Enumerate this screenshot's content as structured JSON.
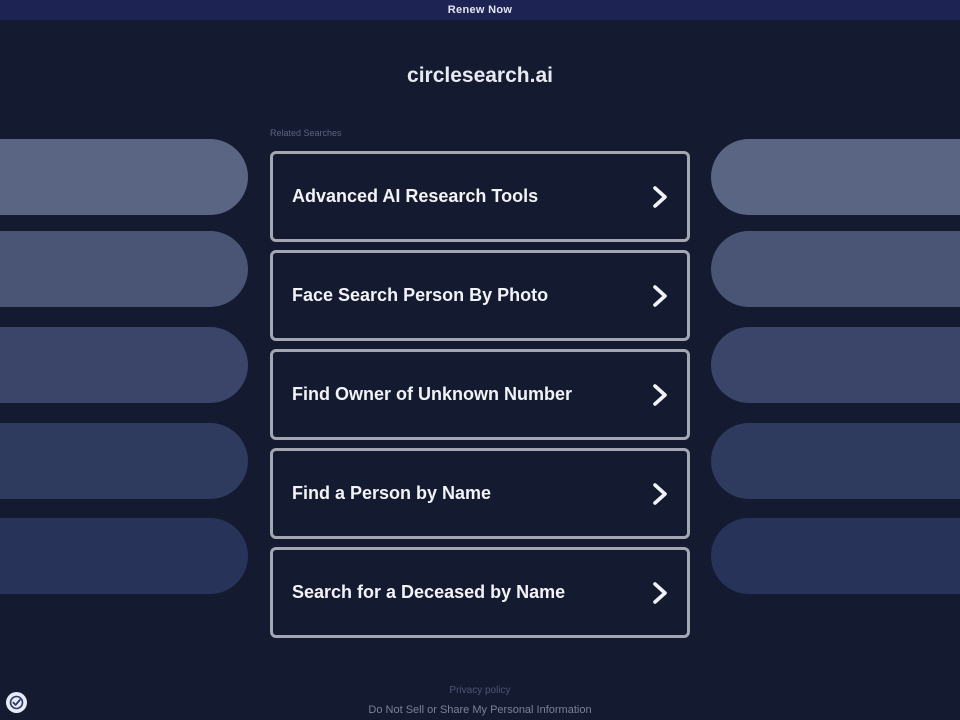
{
  "topbar": {
    "renew_label": "Renew Now"
  },
  "domain": "circlesearch.ai",
  "related_label": "Related Searches",
  "results": [
    {
      "label": "Advanced AI Research Tools"
    },
    {
      "label": "Face Search Person By Photo"
    },
    {
      "label": "Find Owner of Unknown Number"
    },
    {
      "label": "Find a Person by Name"
    },
    {
      "label": "Search for a Deceased by Name"
    }
  ],
  "side_pill_colors": [
    "#5a6583",
    "#4a5576",
    "#3a4569",
    "#2f3a5f",
    "#28335a"
  ],
  "footer": {
    "privacy_label": "Privacy policy",
    "dnsp_label": "Do Not Sell or Share My Personal Information"
  },
  "icons": {
    "result_arrow": "chevron-right-icon",
    "badge": "privacy-shield-icon"
  }
}
